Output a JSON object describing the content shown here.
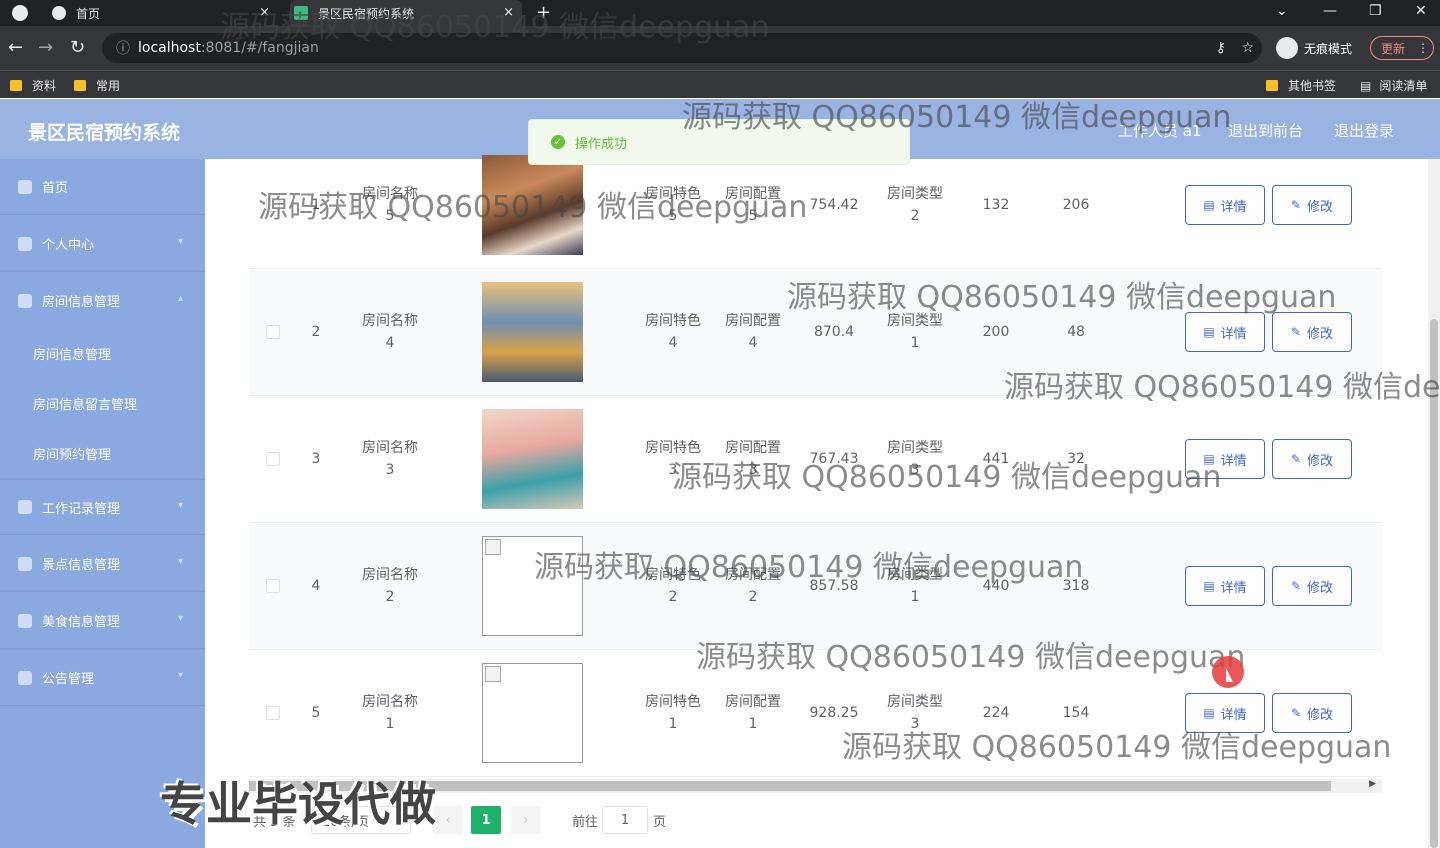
{
  "browser": {
    "tabs": [
      {
        "title": "首页"
      },
      {
        "title": "景区民宿预约系统"
      }
    ],
    "tab_close": "×",
    "new_tab": "+",
    "url_host": "localhost",
    "url_path": ":8081/#/fangjian",
    "incognito_label": "无痕模式",
    "update_label": "更新",
    "bookmarks": [
      "资料",
      "常用"
    ],
    "bookmarks_right": [
      "其他书签",
      "阅读清单"
    ]
  },
  "app": {
    "title": "景区民宿预约系统",
    "user": "工作人员 a1",
    "back_front": "退出到前台",
    "logout": "退出登录"
  },
  "sidebar": {
    "items": [
      {
        "label": "首页"
      },
      {
        "label": "个人中心"
      },
      {
        "label": "房间信息管理"
      },
      {
        "label": "工作记录管理"
      },
      {
        "label": "景点信息管理"
      },
      {
        "label": "美食信息管理"
      },
      {
        "label": "公告管理"
      }
    ],
    "sub_items": [
      {
        "label": "房间信息管理"
      },
      {
        "label": "房间信息留言管理"
      },
      {
        "label": "房间预约管理"
      }
    ]
  },
  "toast": {
    "message": "操作成功"
  },
  "table": {
    "rows": [
      {
        "index": "1",
        "name_label": "房间名称",
        "name_value": "5",
        "feature_label": "房间特色",
        "feature_value": "5",
        "config_label": "房间配置",
        "config_value": "5",
        "price": "754.42",
        "type_label": "房间类型",
        "type_value": "2",
        "col_a": "132",
        "col_b": "206",
        "image": "photo"
      },
      {
        "index": "2",
        "name_label": "房间名称",
        "name_value": "4",
        "feature_label": "房间特色",
        "feature_value": "4",
        "config_label": "房间配置",
        "config_value": "4",
        "price": "870.4",
        "type_label": "房间类型",
        "type_value": "1",
        "col_a": "200",
        "col_b": "48",
        "image": "photo"
      },
      {
        "index": "3",
        "name_label": "房间名称",
        "name_value": "3",
        "feature_label": "房间特色",
        "feature_value": "3",
        "config_label": "房间配置",
        "config_value": "3",
        "price": "767.43",
        "type_label": "房间类型",
        "type_value": "3",
        "col_a": "441",
        "col_b": "32",
        "image": "photo"
      },
      {
        "index": "4",
        "name_label": "房间名称",
        "name_value": "2",
        "feature_label": "房间特色",
        "feature_value": "2",
        "config_label": "房间配置",
        "config_value": "2",
        "price": "857.58",
        "type_label": "房间类型",
        "type_value": "1",
        "col_a": "440",
        "col_b": "318",
        "image": "broken"
      },
      {
        "index": "5",
        "name_label": "房间名称",
        "name_value": "1",
        "feature_label": "房间特色",
        "feature_value": "1",
        "config_label": "房间配置",
        "config_value": "1",
        "price": "928.25",
        "type_label": "房间类型",
        "type_value": "3",
        "col_a": "224",
        "col_b": "154",
        "image": "broken"
      }
    ],
    "detail_label": "详情",
    "edit_label": "修改"
  },
  "pagination": {
    "total": "共 5 条",
    "page_size": "10条/页",
    "current_page": "1",
    "goto_label": "前往",
    "goto_value": "1",
    "page_suffix": "页"
  },
  "watermarks": [
    "源码获取 QQ86050149 微信deepguan",
    "源码获取 QQ86050149 微信deepguan",
    "源码获取 QQ86050149 微信deepguan",
    "源码获取 QQ86050149 微信deepguan",
    "源码获取 QQ86050149 微信dee",
    "源码获取 QQ86050149 微信deepguan",
    "源码获取 QQ86050149 微信deepguan",
    "源码获取 QQ86050149 微信deepguan",
    "源码获取 QQ86050149 微信deepguan"
  ],
  "promo": "专业毕设代做"
}
